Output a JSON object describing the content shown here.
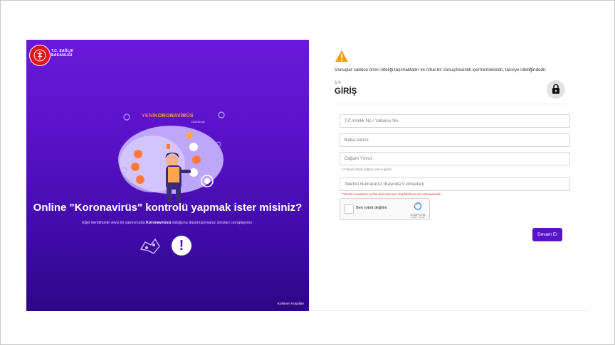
{
  "brand": {
    "line1": "T.C. SAĞLIK",
    "line2": "BAKANLIĞI"
  },
  "campaign": {
    "yeni": "YENİ",
    "koronavirus": "KORONAVİRÜS",
    "covid": "COVID-19"
  },
  "hero": {
    "heading": "Online \"Koronavirüs\" kontrolü yapmak ister misiniz?",
    "subtitle_before": "Eğer kendinizde veya bir yakınınızda ",
    "subtitle_bold": "Koronavirüsü",
    "subtitle_after": " olduğunu düşünüyorsanız soruları cevaplayınız.",
    "warning_glyph": "!",
    "footer_link": "Kullanım Koşulları"
  },
  "form": {
    "disclaimer": "Sonuçlar sadece öneri niteliği taşımaktadır ve nihai bir sonuç/kesinlik içermemektedir, tavsiye niteliğindedir.",
    "step": "1/4",
    "title": "GİRİŞ",
    "fields": {
      "tc": {
        "placeholder": "T.C.Kimlik No / Yabancı No"
      },
      "father": {
        "placeholder": "Baba Adınız"
      },
      "birth": {
        "placeholder": "Doğum Yılınız",
        "hint": "* 4 haneli olarak doğum yılınızı giriniz."
      },
      "phone": {
        "placeholder": "Telefon Numaranız (başında 0 olmadan)",
        "hint": "* Telefon numaranız acil bir durumda size ulaşılabilmesi için istenmektedir."
      }
    },
    "captcha": {
      "label": "Ben robot değilim",
      "brand": "reCAPTCHA",
      "terms": "Gizlilik - Şartlar"
    },
    "submit": "Devam Et"
  },
  "colors": {
    "primary": "#5a14c8",
    "warning": "#f39c12",
    "error": "#e0342b",
    "brand_red": "#e3151a"
  }
}
